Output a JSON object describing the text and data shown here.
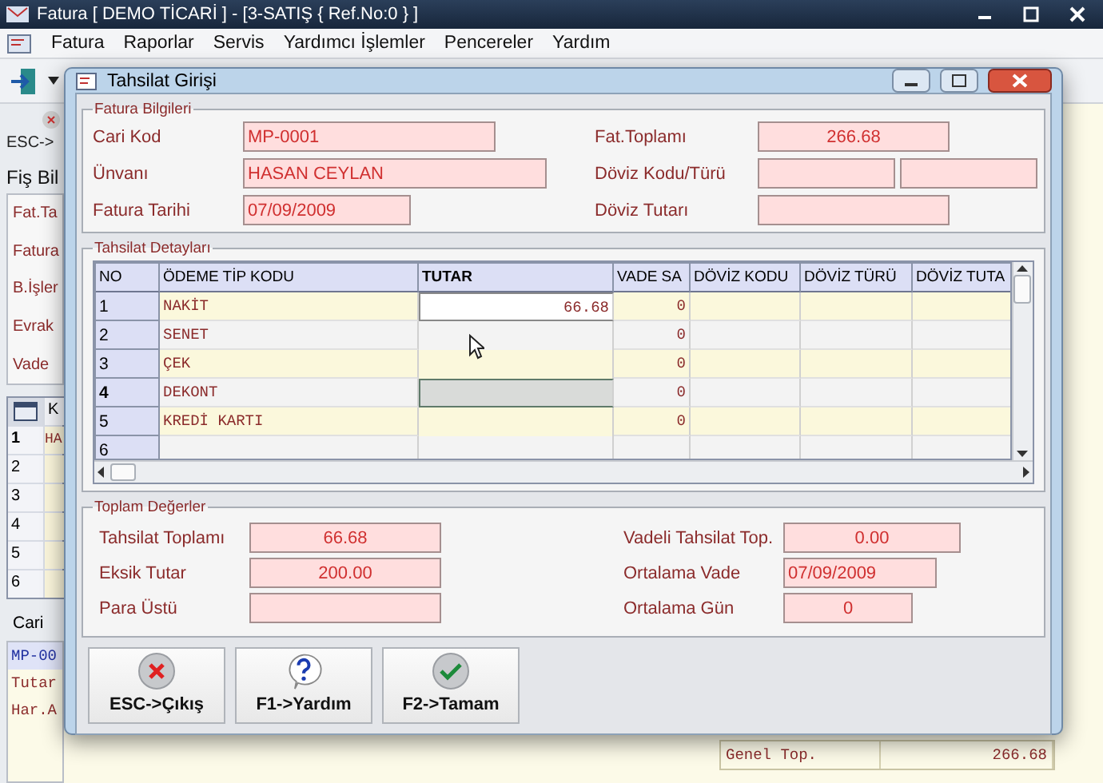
{
  "app": {
    "title": "Fatura [ DEMO TİCARİ ]  - [3-SATIŞ { Ref.No:0 } ]",
    "menu": [
      "Fatura",
      "Raporlar",
      "Servis",
      "Yardımcı İşlemler",
      "Pencereler",
      "Yardım"
    ],
    "side": {
      "esc_label": "ESC->",
      "section": "Fiş Bil",
      "fields": [
        "Fat.Ta",
        "Fatura",
        "B.İşler",
        "Evrak",
        "Vade"
      ],
      "grid_header": "K",
      "grid_rows": [
        {
          "no": "1",
          "text": "HA",
          "current": true
        },
        {
          "no": "2",
          "current": false
        },
        {
          "no": "3",
          "current": false
        },
        {
          "no": "4",
          "current": false
        },
        {
          "no": "5",
          "current": false
        },
        {
          "no": "6",
          "current": false
        }
      ],
      "tab": "Cari",
      "lines": [
        {
          "text": "MP-00",
          "kind": "code"
        },
        {
          "text": "Tutar",
          "kind": "label"
        },
        {
          "text": "Har.A",
          "kind": "label"
        }
      ]
    },
    "total": {
      "label": "Genel Top.",
      "value": "266.68"
    }
  },
  "dialog": {
    "title": "Tahsilat Girişi",
    "invoice": {
      "legend": "Fatura Bilgileri",
      "fields": [
        {
          "label": "Cari Kod",
          "value": "MP-0001"
        },
        {
          "label": "Ünvanı",
          "value": "HASAN CEYLAN"
        },
        {
          "label": "Fatura Tarihi",
          "value": "07/09/2009"
        }
      ],
      "right_fields": [
        {
          "label": "Fat.Toplamı",
          "kind": "single",
          "value": "266.68"
        },
        {
          "label": "Döviz Kodu/Türü",
          "kind": "pair"
        },
        {
          "label": "Döviz Tutarı",
          "kind": "single"
        }
      ]
    },
    "details": {
      "legend": "Tahsilat Detayları",
      "columns": [
        "NO",
        "ÖDEME TİP KODU",
        "TUTAR",
        "VADE SA",
        "DÖVİZ KODU",
        "DÖVİZ TÜRÜ",
        "DÖVİZ TUTA"
      ],
      "rows": [
        {
          "no": "1",
          "type": "NAKİT",
          "amount": "66.68",
          "vade": "0",
          "current": false,
          "editing": true
        },
        {
          "no": "2",
          "type": "SENET",
          "vade": "0",
          "current": false,
          "editing": false
        },
        {
          "no": "3",
          "type": "ÇEK",
          "vade": "0",
          "current": false,
          "editing": false
        },
        {
          "no": "4",
          "type": "DEKONT",
          "vade": "0",
          "current": true,
          "editing": false
        },
        {
          "no": "5",
          "type": "KREDİ KARTI",
          "vade": "0",
          "current": false,
          "editing": false
        },
        {
          "no": "6",
          "current": false,
          "editing": false
        }
      ]
    },
    "totals": {
      "legend": "Toplam Değerler",
      "left": [
        {
          "label": "Tahsilat Toplamı",
          "value": "66.68"
        },
        {
          "label": "Eksik Tutar",
          "value": "200.00"
        },
        {
          "label": "Para Üstü"
        }
      ],
      "right": [
        {
          "label": "Vadeli Tahsilat Top.",
          "value": "0.00"
        },
        {
          "label": "Ortalama Vade",
          "value": "07/09/2009"
        },
        {
          "label": "Ortalama Gün",
          "value": "0"
        }
      ]
    },
    "buttons": [
      {
        "label": "ESC->Çıkış",
        "kind": "cancel"
      },
      {
        "label": "F1->Yardım",
        "kind": "help"
      },
      {
        "label": "F2->Tamam",
        "kind": "ok"
      }
    ]
  }
}
